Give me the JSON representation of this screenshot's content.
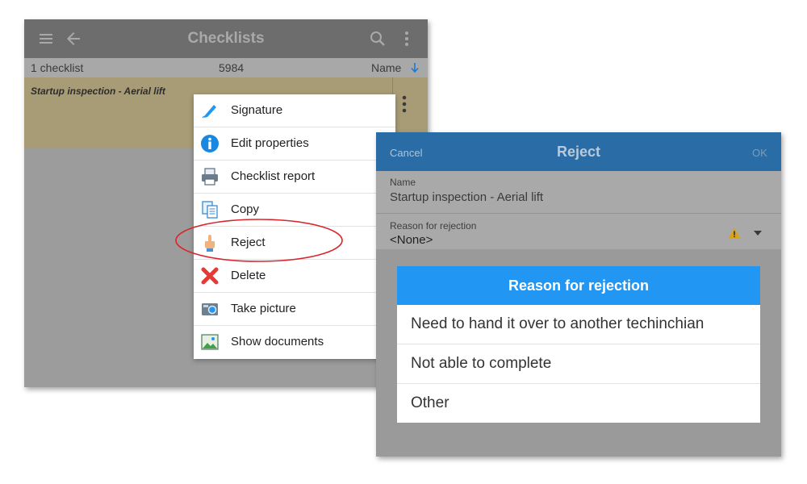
{
  "checklists_window": {
    "title": "Checklists",
    "subbar": {
      "count": "1 checklist",
      "number": "5984",
      "sort_label": "Name"
    },
    "row": {
      "title": "Startup inspection - Aerial lift"
    }
  },
  "context_menu": {
    "items": [
      {
        "label": "Signature",
        "icon": "pen-icon"
      },
      {
        "label": "Edit properties",
        "icon": "info-icon"
      },
      {
        "label": "Checklist report",
        "icon": "printer-icon"
      },
      {
        "label": "Copy",
        "icon": "copy-icon"
      },
      {
        "label": "Reject",
        "icon": "hand-icon"
      },
      {
        "label": "Delete",
        "icon": "delete-x-icon"
      },
      {
        "label": "Take picture",
        "icon": "camera-icon"
      },
      {
        "label": "Show documents",
        "icon": "documents-icon"
      }
    ],
    "highlighted_item": "Reject"
  },
  "reject_dialog": {
    "cancel_label": "Cancel",
    "title": "Reject",
    "ok_label": "OK",
    "name_field": {
      "label": "Name",
      "value": "Startup inspection - Aerial lift"
    },
    "reason_field": {
      "label": "Reason for rejection",
      "value": "<None>"
    },
    "picker": {
      "title": "Reason for rejection",
      "options": [
        "Need to hand it over to another techinchian",
        "Not able to complete",
        "Other"
      ]
    }
  },
  "colors": {
    "dialog_header": "#2a6da6",
    "picker_header": "#2196f3",
    "highlight_ellipse": "#d9262b",
    "row_background": "#a79c76"
  }
}
